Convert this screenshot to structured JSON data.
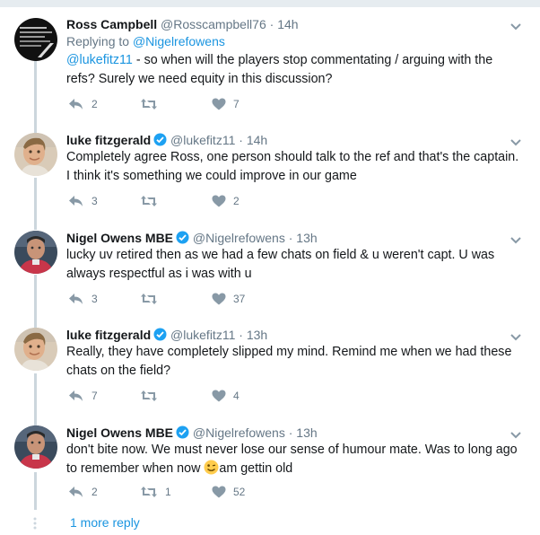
{
  "tweets": [
    {
      "name": "Ross Campbell",
      "handle": "@Rosscampbell76",
      "time": "14h",
      "reply_prefix": "Replying to",
      "reply_handle": "@Nigelrefowens",
      "text_link": "@lukefitz11",
      "text_line1": " - so when will the players stop commentating / arguing with the",
      "text_line2": "refs? Surely we need equity in this discussion?",
      "reply_count": "2",
      "retweet_count": "",
      "like_count": "7"
    },
    {
      "name": "luke fitzgerald",
      "handle": "@lukefitz11",
      "time": "14h",
      "text_line1": "Completely agree Ross, one person should talk to the ref and that's the captain.",
      "text_line2": "I think it's something we could improve in our game",
      "reply_count": "3",
      "retweet_count": "",
      "like_count": "2"
    },
    {
      "name": "Nigel Owens MBE",
      "handle": "@Nigelrefowens",
      "time": "13h",
      "text_line1": "lucky uv retired then as we had a few chats on field & u weren't capt. U was",
      "text_line2": "always respectful as i was with u",
      "reply_count": "3",
      "retweet_count": "",
      "like_count": "37"
    },
    {
      "name": "luke fitzgerald",
      "handle": "@lukefitz11",
      "time": "13h",
      "text_line1": "Really, they have completely slipped my mind. Remind me when we had these",
      "text_line2": "chats on the field?",
      "reply_count": "7",
      "retweet_count": "",
      "like_count": "4"
    },
    {
      "name": "Nigel Owens MBE",
      "handle": "@Nigelrefowens",
      "time": "13h",
      "text_line1": "don't bite now. We must never lose our sense of humour mate. Was to long ago",
      "text_line2a": "to remember when now ",
      "text_line2b": "am gettin old",
      "reply_count": "2",
      "retweet_count": "1",
      "like_count": "52"
    }
  ],
  "more_replies": "1 more reply",
  "icons": {
    "reply": "reply-icon",
    "retweet": "retweet-icon",
    "like": "heart-icon",
    "verified": "verified-badge-icon",
    "caret": "chevron-down-icon"
  },
  "colors": {
    "link": "#1b95e0",
    "secondary": "#657786",
    "verified": "#1da1f2",
    "thread_line": "#ccd6dd"
  }
}
